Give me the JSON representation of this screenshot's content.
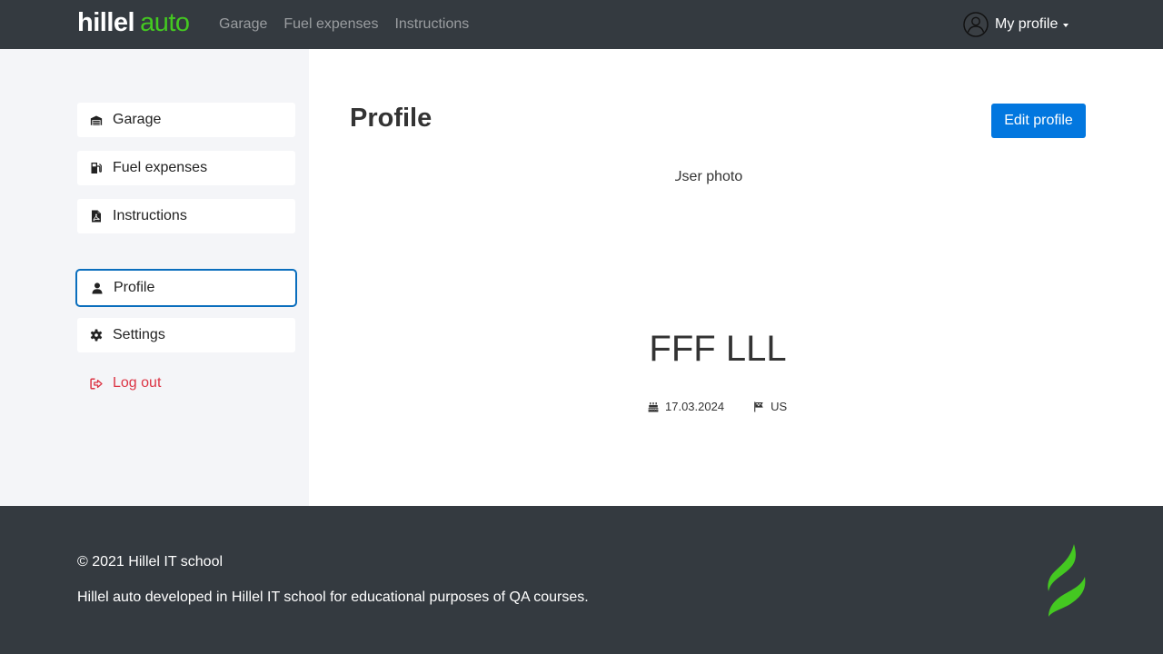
{
  "header": {
    "logo_part1": "hillel",
    "logo_part2": "auto",
    "nav": [
      "Garage",
      "Fuel expenses",
      "Instructions"
    ],
    "profile_label": "My profile"
  },
  "sidebar": {
    "items": [
      {
        "label": "Garage",
        "icon": "garage-icon"
      },
      {
        "label": "Fuel expenses",
        "icon": "fuel-icon"
      },
      {
        "label": "Instructions",
        "icon": "document-icon"
      },
      {
        "label": "Profile",
        "icon": "person-icon",
        "active": true
      },
      {
        "label": "Settings",
        "icon": "gear-icon"
      },
      {
        "label": "Log out",
        "icon": "logout-icon"
      }
    ]
  },
  "main": {
    "title": "Profile",
    "edit_button": "Edit profile",
    "photo_alt": "User photo",
    "user_name": "FFF LLL",
    "birth_date": "17.03.2024",
    "country": "US"
  },
  "footer": {
    "copyright": "© 2021 Hillel IT school",
    "description": "Hillel auto developed in Hillel IT school for educational purposes of QA courses."
  },
  "colors": {
    "header_bg": "#343a40",
    "accent_green": "#44c821",
    "primary_blue": "#0277df",
    "danger_red": "#dc3545",
    "sidebar_bg": "#f4f5f8"
  }
}
